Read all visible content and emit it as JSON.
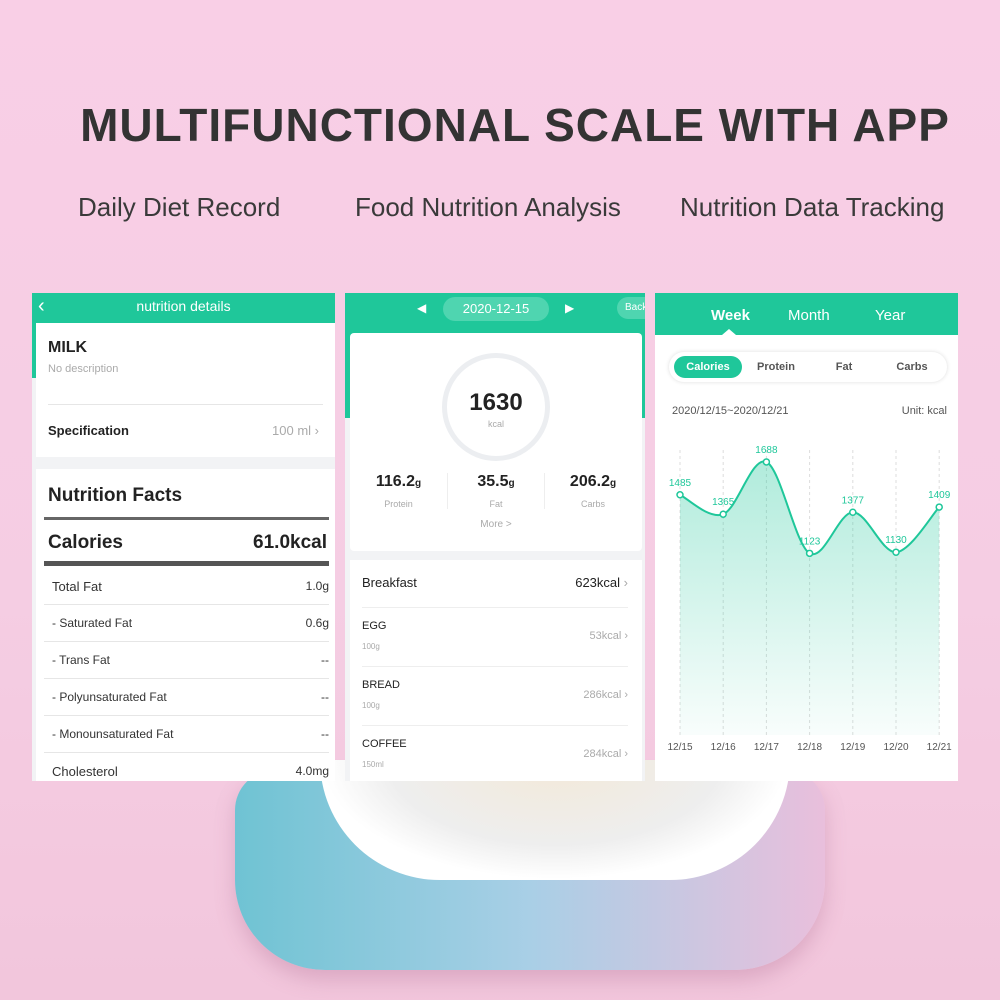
{
  "headline": "MULTIFUNCTIONAL SCALE WITH APP",
  "features": [
    "Daily Diet Record",
    "Food Nutrition Analysis",
    "Nutrition Data Tracking"
  ],
  "accent": "#1fc79a",
  "left": {
    "header": "nutrition details",
    "back_icon": "chevron-left",
    "food": "MILK",
    "desc": "No description",
    "spec_label": "Specification",
    "spec_value": "100 ml",
    "facts_title": "Nutrition Facts",
    "cal_label": "Calories",
    "cal_value": "61.0kcal",
    "rows": [
      {
        "label": "Total Fat",
        "value": "1.0g"
      },
      {
        "label": "- Saturated Fat",
        "value": "0.6g"
      },
      {
        "label": "- Trans Fat",
        "value": "--"
      },
      {
        "label": "- Polyunsaturated Fat",
        "value": "--"
      },
      {
        "label": "- Monounsaturated Fat",
        "value": "--"
      },
      {
        "label": "Cholesterol",
        "value": "4.0mg"
      }
    ]
  },
  "middle": {
    "date": "2020-12-15",
    "back": "Back",
    "total": "1630",
    "unit": "kcal",
    "macros": [
      {
        "value": "116.2",
        "unit": "g",
        "label": "Protein"
      },
      {
        "value": "35.5",
        "unit": "g",
        "label": "Fat"
      },
      {
        "value": "206.2",
        "unit": "g",
        "label": "Carbs"
      }
    ],
    "more": "More >",
    "meal": "Breakfast",
    "meal_kcal": "623kcal",
    "foods": [
      {
        "name": "EGG",
        "qty": "100g",
        "kcal": "53kcal"
      },
      {
        "name": "BREAD",
        "qty": "100g",
        "kcal": "286kcal"
      },
      {
        "name": "COFFEE",
        "qty": "150ml",
        "kcal": "284kcal"
      }
    ]
  },
  "right": {
    "tabs": [
      "Week",
      "Month",
      "Year"
    ],
    "active_tab": "Week",
    "pills": [
      "Calories",
      "Protein",
      "Fat",
      "Carbs"
    ],
    "active_pill": "Calories",
    "range": "2020/12/15~2020/12/21",
    "unit": "Unit: kcal"
  },
  "chart_data": {
    "type": "area",
    "x": [
      "12/15",
      "12/16",
      "12/17",
      "12/18",
      "12/19",
      "12/20",
      "12/21"
    ],
    "values": [
      1485,
      1365,
      1688,
      1123,
      1377,
      1130,
      1409
    ],
    "ylim": [
      0,
      1700
    ],
    "grid": "vertical dashed",
    "color": "#1fc79a"
  }
}
